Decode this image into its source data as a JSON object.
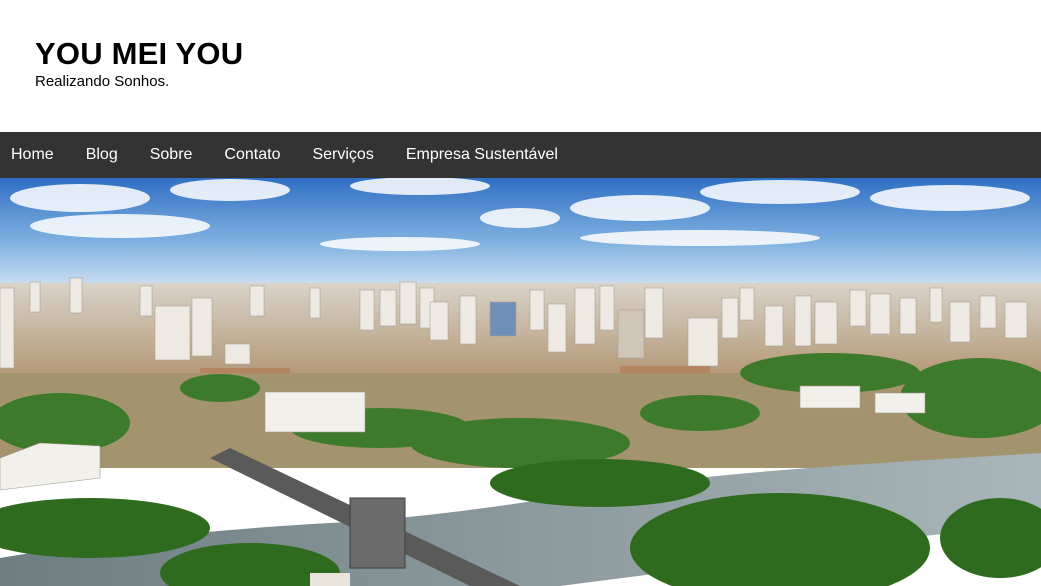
{
  "site": {
    "title": "YOU MEI YOU",
    "tagline": "Realizando Sonhos."
  },
  "nav": {
    "items": [
      {
        "label": "Home"
      },
      {
        "label": "Blog"
      },
      {
        "label": "Sobre"
      },
      {
        "label": "Contato"
      },
      {
        "label": "Serviços"
      },
      {
        "label": "Empresa Sustentável"
      }
    ]
  },
  "hero": {
    "subject": "aerial photo of a city with skyscrapers, a river and green trees",
    "colors": {
      "sky_top": "#3a78c8",
      "sky_bottom": "#cfe0f0",
      "city": "#c9b9a3",
      "trees": "#3f7a2a",
      "river": "#7d8c92"
    }
  },
  "theme": {
    "nav_background": "#333333",
    "nav_text": "#ffffff",
    "header_background": "#ffffff"
  }
}
